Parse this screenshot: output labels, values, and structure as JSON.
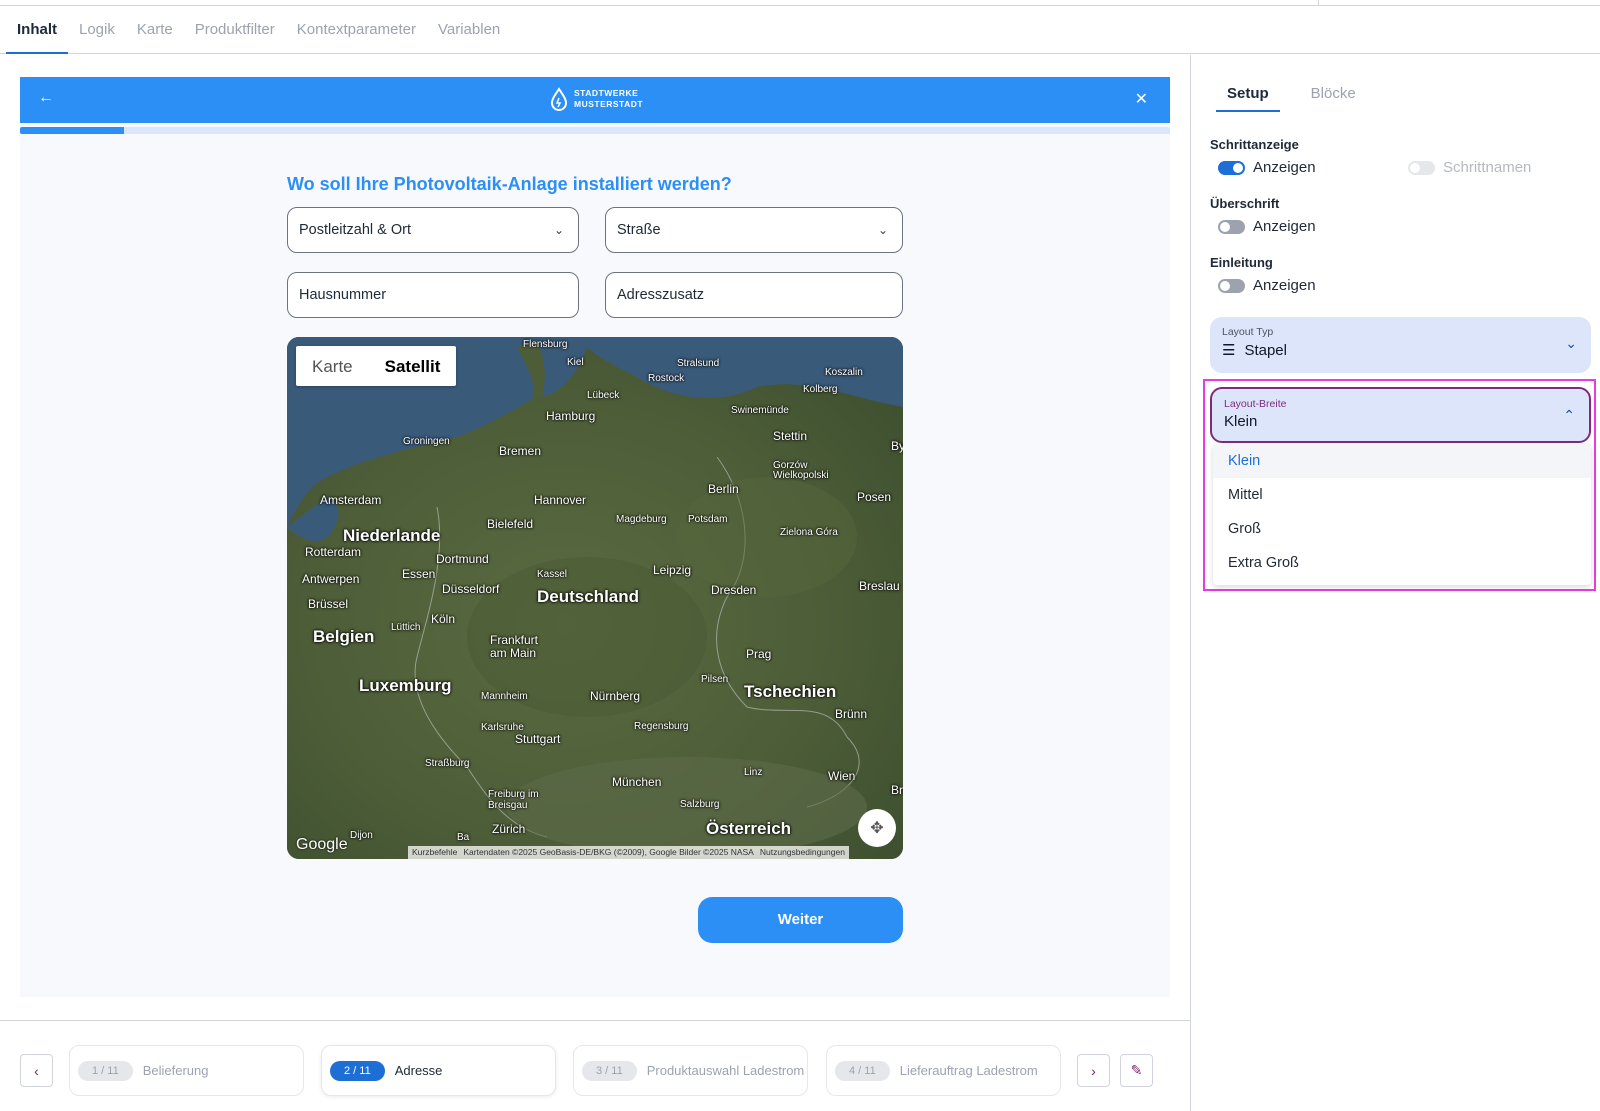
{
  "tabs": [
    "Inhalt",
    "Logik",
    "Karte",
    "Produktfilter",
    "Kontextparameter",
    "Variablen"
  ],
  "preview": {
    "logo_line1": "STADTWERKE",
    "logo_line2": "MUSTERSTADT",
    "progress_fraction": 0.09,
    "question": "Wo soll Ihre Photovoltaik-Anlage installiert werden?",
    "fields": {
      "plz_ort": "Postleitzahl & Ort",
      "strasse": "Straße",
      "hausnummer": "Hausnummer",
      "adresszusatz": "Adresszusatz"
    },
    "map": {
      "type_karte": "Karte",
      "type_satellit": "Satellit",
      "google": "Google",
      "attr_shortcuts": "Kurzbefehle",
      "attr_data": "Kartendaten ©2025 GeoBasis-DE/BKG (©2009), Google Bilder ©2025 NASA",
      "attr_terms": "Nutzungsbedingungen",
      "labels": {
        "flensburg": "Flensburg",
        "kiel": "Kiel",
        "stralsund": "Stralsund",
        "rostock": "Rostock",
        "koszalin": "Koszalin",
        "kolberg": "Kolberg",
        "luebeck": "Lübeck",
        "hamburg": "Hamburg",
        "swinemuende": "Swinemünde",
        "stettin": "Stettin",
        "groningen": "Groningen",
        "bremen": "Bremen",
        "by": "By",
        "gorzow": "Gorzów Wielkopolski",
        "amsterdam": "Amsterdam",
        "hannover": "Hannover",
        "berlin": "Berlin",
        "posen": "Posen",
        "niederlande": "Niederlande",
        "bielefeld": "Bielefeld",
        "magdeburg": "Magdeburg",
        "potsdam": "Potsdam",
        "rotterdam": "Rotterdam",
        "dortmund": "Dortmund",
        "zielona": "Zielona Góra",
        "antwerpen": "Antwerpen",
        "essen": "Essen",
        "kassel": "Kassel",
        "leipzig": "Leipzig",
        "duesseldorf": "Düsseldorf",
        "dresden": "Dresden",
        "breslau": "Breslau",
        "bruessel": "Brüssel",
        "deutschland": "Deutschland",
        "koeln": "Köln",
        "luettich": "Lüttich",
        "belgien": "Belgien",
        "frankfurt1": "Frankfurt",
        "frankfurt2": "am Main",
        "prag": "Prag",
        "luxemburg": "Luxemburg",
        "mannheim": "Mannheim",
        "nuernberg": "Nürnberg",
        "pilsen": "Pilsen",
        "tschechien": "Tschechien",
        "bruenn": "Brünn",
        "karlsruhe": "Karlsruhe",
        "stuttgart": "Stuttgart",
        "regensburg": "Regensburg",
        "strassburg": "Straßburg",
        "linz": "Linz",
        "muenchen": "München",
        "wien": "Wien",
        "br": "Br",
        "freiburg1": "Freiburg im",
        "freiburg2": "Breisgau",
        "salzburg": "Salzburg",
        "zuerich": "Zürich",
        "oesterreich": "Österreich",
        "dijon": "Dijon",
        "ba": "Ba"
      }
    },
    "next_button": "Weiter"
  },
  "stepper": {
    "steps": [
      {
        "badge": "1 / 11",
        "label": "Belieferung"
      },
      {
        "badge": "2 / 11",
        "label": "Adresse"
      },
      {
        "badge": "3 / 11",
        "label": "Produktauswahl Ladestrom"
      },
      {
        "badge": "4 / 11",
        "label": "Lieferauftrag Ladestrom"
      }
    ]
  },
  "panel": {
    "tabs": [
      "Setup",
      "Blöcke"
    ],
    "schrittanzeige": "Schrittanzeige",
    "ueberschrift": "Überschrift",
    "einleitung": "Einleitung",
    "anzeigen": "Anzeigen",
    "schrittnamen": "Schrittnamen",
    "layout_typ_label": "Layout Typ",
    "layout_typ_value": "Stapel",
    "layout_breite_label": "Layout-Breite",
    "layout_breite_value": "Klein",
    "options": [
      "Klein",
      "Mittel",
      "Groß",
      "Extra Groß"
    ]
  },
  "colors": {
    "primary": "#2b8ff5",
    "accent": "#1d6fd6",
    "highlight": "#e73ae0"
  }
}
